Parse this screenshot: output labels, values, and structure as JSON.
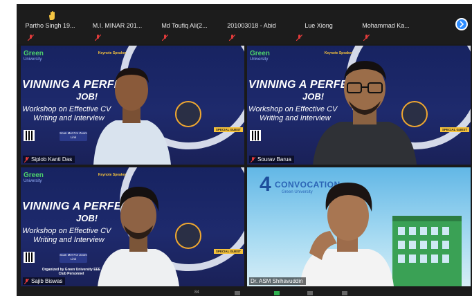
{
  "thumbnails": [
    {
      "name": "Partho Singh 19..."
    },
    {
      "name": "M.I. MINAR 201..."
    },
    {
      "name": "Md Toufiq Ali(2..."
    },
    {
      "name": "201003018 - Abid"
    },
    {
      "name": "Lue Xiong"
    },
    {
      "name": "Mohammad Ka..."
    }
  ],
  "tiles": [
    {
      "name": "Siplob Kanti Das"
    },
    {
      "name": "Sourav Barua"
    },
    {
      "name": "Sajib Biswas"
    },
    {
      "name": "Dr. ASM Shihavuddin"
    }
  ],
  "poster": {
    "logo": "Green",
    "logo_sub": "University",
    "keynote": "Keynote Speaker",
    "keynote_desc": "Biplob Kanti Das\nDeputy Director\nCenter for Career Development\nGreen University of Bangladesh",
    "title1": "VINNING A PERFECT",
    "title2": "JOB!",
    "sub1": "Workshop on Effective CV",
    "sub2": "Writing and Interview",
    "scan": "Scan Me! For Zoom Link",
    "organized": "Organized by\nGreen University EEE Club Personnel",
    "special": "SPECIAL GUEST"
  },
  "convocation": {
    "num": "4",
    "label": "CONVOCATION",
    "sub": "Green University"
  },
  "bottombar": {
    "participants": "84"
  },
  "colors": {
    "accent": "#2d8cff",
    "active_speaker": "#cdd84a",
    "muted": "#e23b3b"
  }
}
